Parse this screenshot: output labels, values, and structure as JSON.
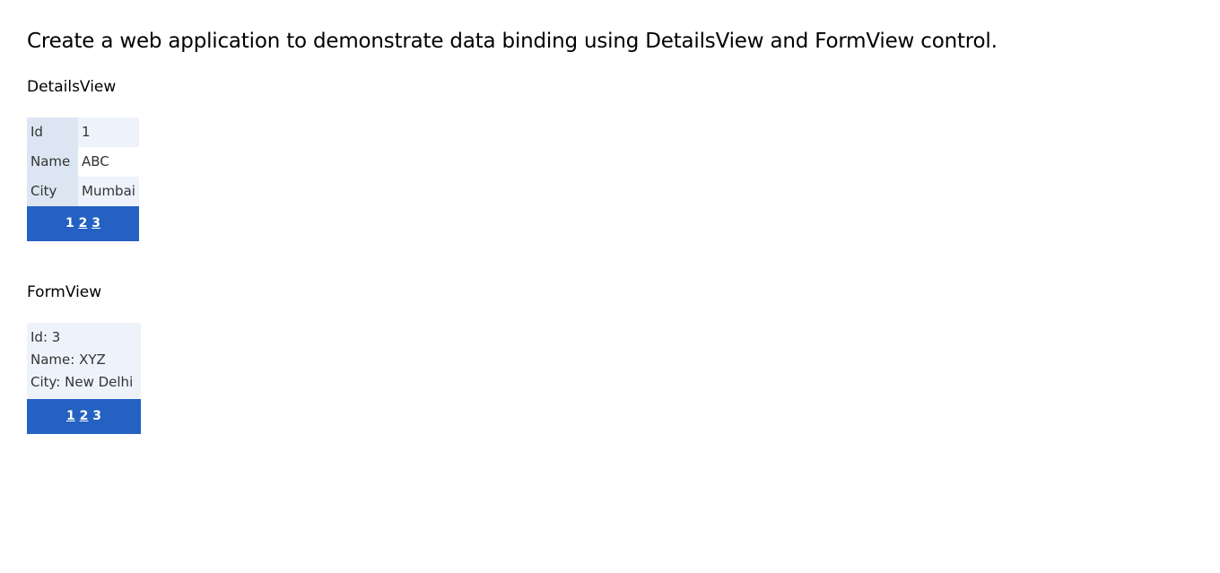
{
  "page_title": "Create a web application to demonstrate data binding using DetailsView and FormView control.",
  "details_view": {
    "heading": "DetailsView",
    "rows": [
      {
        "label": "Id",
        "value": "1"
      },
      {
        "label": "Name",
        "value": "ABC"
      },
      {
        "label": "City",
        "value": "Mumbai"
      }
    ],
    "pager": {
      "current": "1",
      "links": [
        "2",
        "3"
      ]
    }
  },
  "form_view": {
    "heading": "FormView",
    "lines": [
      "Id: 3",
      "Name: XYZ",
      "City: New Delhi"
    ],
    "pager": {
      "links": [
        "1",
        "2"
      ],
      "current": "3"
    }
  },
  "colors": {
    "pager_background": "#2461c2",
    "field_header_background": "#dce6f2",
    "alt_row_background": "#eef3fb",
    "text": "#333333"
  }
}
